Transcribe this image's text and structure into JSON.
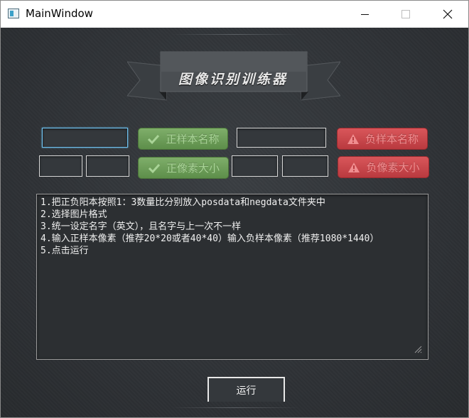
{
  "window": {
    "title": "MainWindow"
  },
  "banner": {
    "title": "图像识别训练器"
  },
  "inputs": {
    "positive_name": {
      "value": ""
    },
    "negative_name": {
      "value": ""
    },
    "positive_width": {
      "value": ""
    },
    "positive_height": {
      "value": ""
    },
    "negative_width": {
      "value": ""
    },
    "negative_height": {
      "value": ""
    }
  },
  "buttons": {
    "positive_name_label": "正样本名称",
    "positive_size_label": "正像素大小",
    "negative_name_label": "负样本名称",
    "negative_size_label": "负像素大小",
    "run_label": "运行"
  },
  "instructions": {
    "text": "1.把正负阳本按照1：3数量比分别放入posdata和negdata文件夹中\n2.选择图片格式\n3.统一设定名字（英文），且名字与上一次不一样\n4.输入正样本像素（推荐20*20或者40*40）输入负样本像素（推荐1080*1440）\n5.点击运行"
  },
  "icons": {
    "app": "app-window-icon",
    "check": "check-icon",
    "warning": "warning-triangle-icon"
  },
  "colors": {
    "background": "#2d3034",
    "green_button": "#6e9e5a",
    "red_button": "#c8484c",
    "focus_border": "#6ec0ee"
  }
}
